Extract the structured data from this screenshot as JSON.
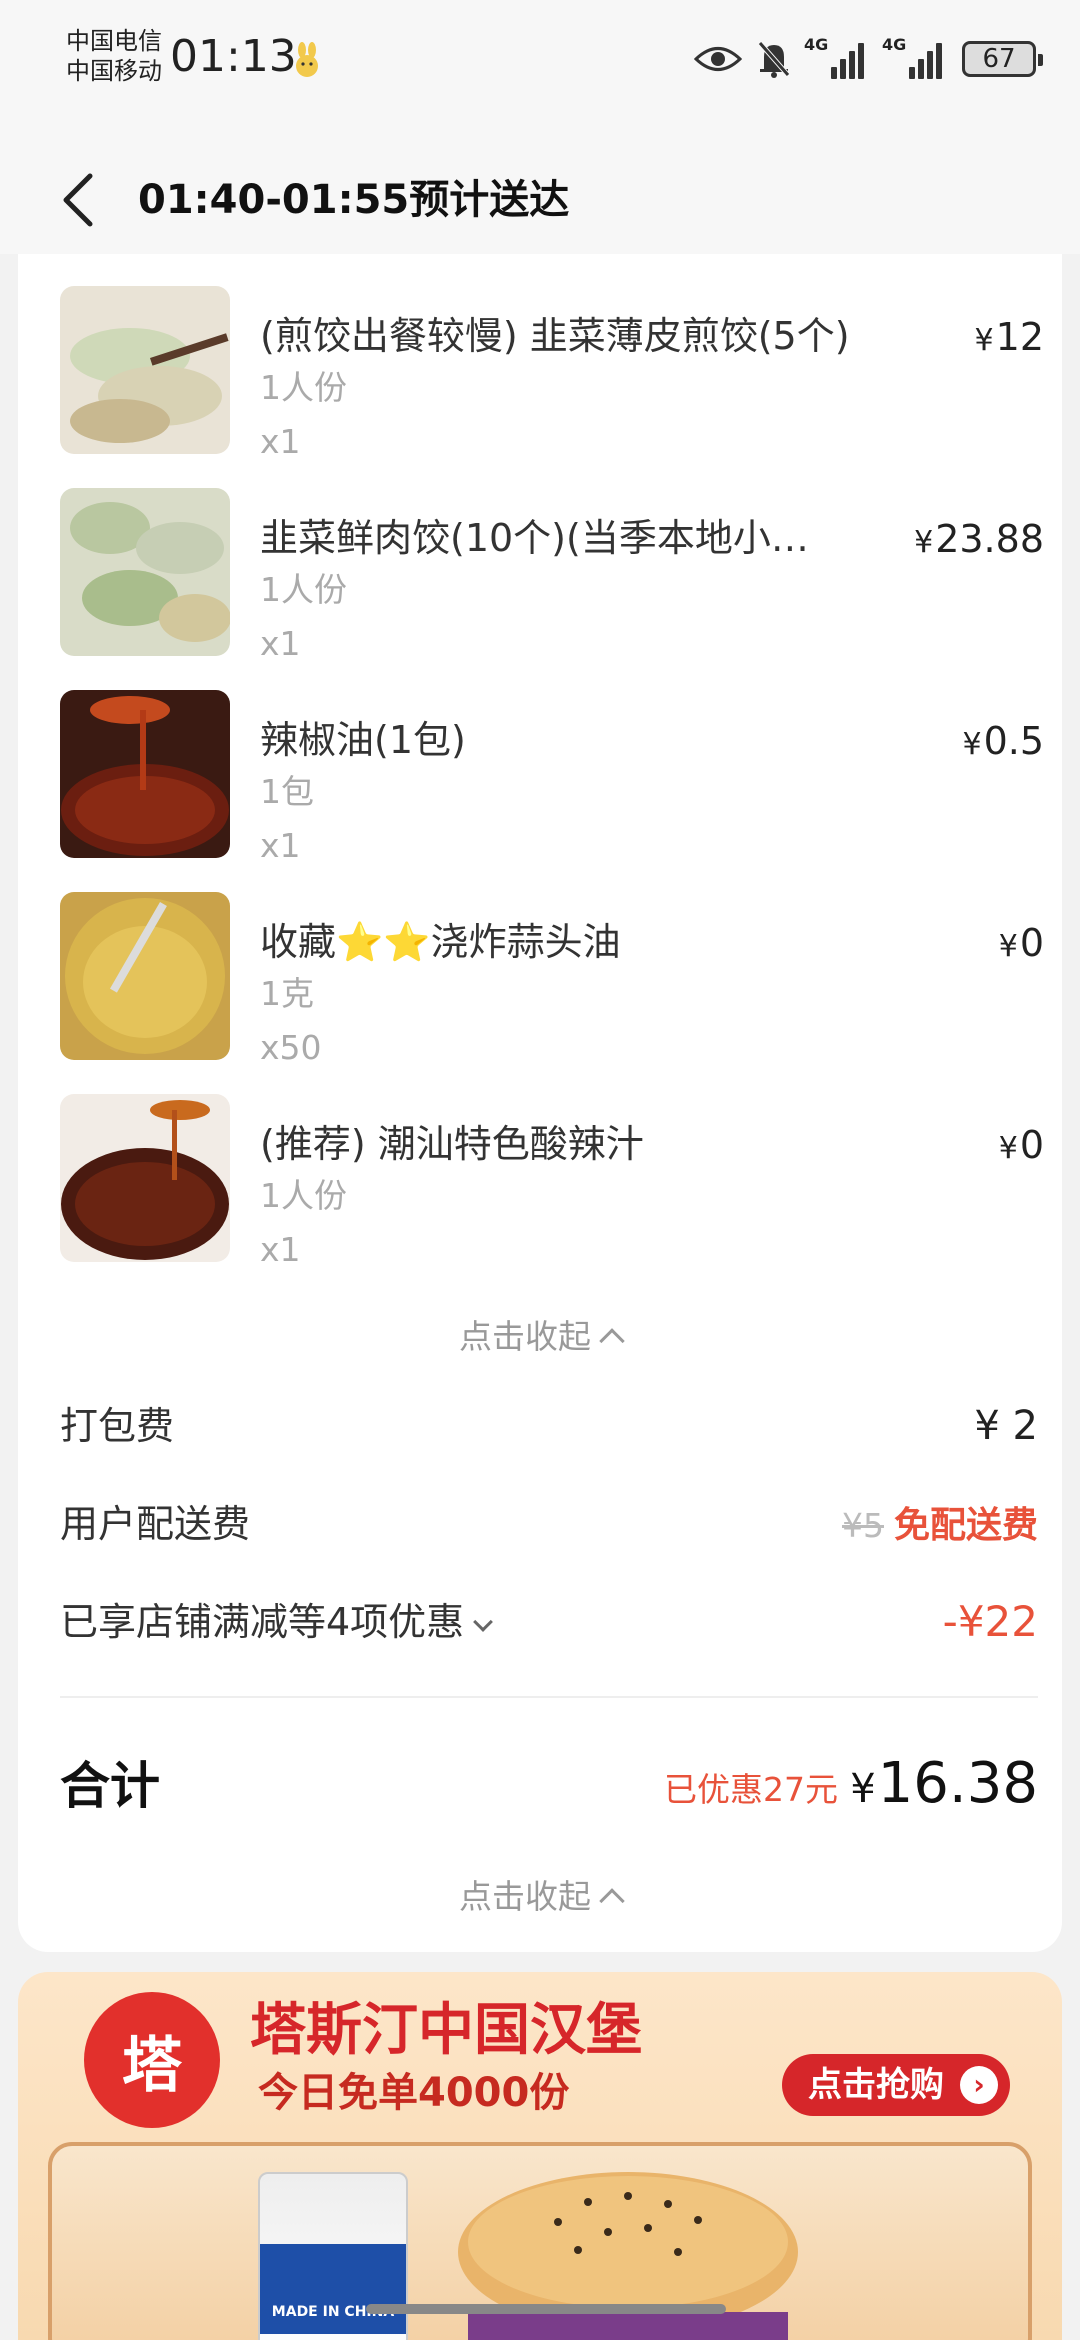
{
  "status_bar": {
    "carrier_1": "中国电信",
    "carrier_2": "中国移动",
    "time": "01:13",
    "network_1": "4G",
    "network_2": "4G",
    "battery": "67"
  },
  "header": {
    "title": "01:40-01:55预计送达"
  },
  "items": [
    {
      "name": "(煎饺出餐较慢) 韭菜薄皮煎饺(5个)",
      "spec": "1人份",
      "qty": "x1",
      "price": "12",
      "thumb": "pan-fried-dumplings"
    },
    {
      "name": "韭菜鲜肉饺(10个)(当季本地小…",
      "spec": "1人份",
      "qty": "x1",
      "price": "23.88",
      "thumb": "boiled-dumplings"
    },
    {
      "name": "辣椒油(1包)",
      "spec": "1包",
      "qty": "x1",
      "price": "0.5",
      "thumb": "chili-oil"
    },
    {
      "name": "收藏⭐⭐浇炸蒜头油",
      "spec": "1克",
      "qty": "x50",
      "price": "0",
      "thumb": "garlic-oil"
    },
    {
      "name": "(推荐) 潮汕特色酸辣汁",
      "spec": "1人份",
      "qty": "x1",
      "price": "0",
      "thumb": "sour-spicy-sauce"
    }
  ],
  "currency": "¥",
  "collapse_label": "点击收起",
  "fees": {
    "packing_label": "打包费",
    "packing_value": "¥ 2",
    "delivery_label": "用户配送费",
    "delivery_original": "¥5",
    "delivery_value": "免配送费",
    "discount_label": "已享店铺满减等4项优惠",
    "discount_value": "-¥22"
  },
  "total": {
    "label": "合计",
    "saved": "已优惠27元",
    "value": "16.38"
  },
  "ad": {
    "title": "塔斯汀中国汉堡",
    "subtitle": "今日免单4000份",
    "button": "点击抢购",
    "logo_text": "塔",
    "cup_text": "MADE IN CHINA"
  },
  "colors": {
    "accent_red": "#e8523a",
    "brand_red": "#d6262a"
  }
}
